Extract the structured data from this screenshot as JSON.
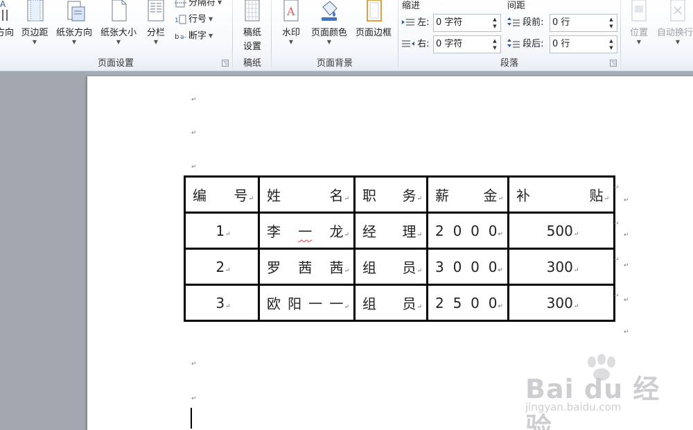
{
  "ribbon": {
    "page_setup": {
      "orientation_label": "方向",
      "margins_label": "页边距",
      "paper_orientation_label": "纸张方向",
      "paper_size_label": "纸张大小",
      "columns_label": "分栏",
      "breaks_label": "分隔符",
      "line_numbers_label": "行号",
      "hyphenation_label": "断字",
      "group_label": "页面设置"
    },
    "manuscript": {
      "button_line1": "稿纸",
      "button_line2": "设置",
      "group_label": "稿纸"
    },
    "page_background": {
      "watermark_label": "水印",
      "page_color_label": "页面颜色",
      "page_borders_label": "页面边框",
      "group_label": "页面背景"
    },
    "paragraph": {
      "indent_heading": "缩进",
      "spacing_heading": "间距",
      "indent_left_label": "左:",
      "indent_left_value": "0 字符",
      "indent_right_label": "右:",
      "indent_right_value": "0 字符",
      "spacing_before_label": "段前:",
      "spacing_before_value": "0 行",
      "spacing_after_label": "段后:",
      "spacing_after_value": "0 行",
      "group_label": "段落"
    },
    "arrange": {
      "position_label": "位置",
      "wrap_text_label": "自动换行"
    }
  },
  "table": {
    "headers": [
      [
        "编",
        "号"
      ],
      [
        "姓",
        "名"
      ],
      [
        "职",
        "务"
      ],
      [
        "薪",
        "金"
      ],
      [
        "补",
        "贴"
      ]
    ],
    "rows": [
      {
        "id": "1",
        "name": [
          "李",
          "一",
          "龙"
        ],
        "title": [
          "经",
          "理"
        ],
        "salary": [
          "2",
          "0",
          "0",
          "0"
        ],
        "allowance": "500"
      },
      {
        "id": "2",
        "name": [
          "罗",
          "茜",
          "茜"
        ],
        "title": [
          "组",
          "员"
        ],
        "salary": [
          "3",
          "0",
          "0",
          "0"
        ],
        "allowance": "300"
      },
      {
        "id": "3",
        "name": [
          "欧",
          "阳",
          "一",
          "一"
        ],
        "title": [
          "组",
          "员"
        ],
        "salary": [
          "2",
          "5",
          "0",
          "0"
        ],
        "allowance": "300"
      }
    ]
  },
  "paragraph_mark": "↵",
  "watermark": {
    "brand": "Bai du 经验",
    "url": "jingyan.baidu.com"
  }
}
